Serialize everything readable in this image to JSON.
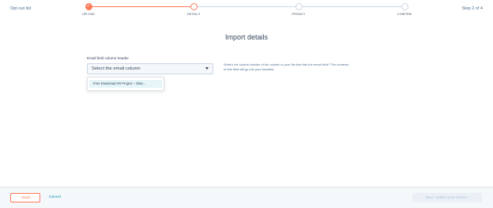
{
  "header": {
    "opt_out_list": "Opt out list",
    "step_count": "Step 2 of 4",
    "steps": [
      {
        "label": "UPLOAD",
        "state": "done"
      },
      {
        "label": "DETAILS",
        "state": "active"
      },
      {
        "label": "PRIVACY",
        "state": "pending"
      },
      {
        "label": "CONFIRM",
        "state": "pending"
      }
    ],
    "done_icon": "✓"
  },
  "main": {
    "title": "Import details",
    "field_label": "Email field column header",
    "select_value": "Select the email column",
    "dropdown_option": "Free Download AR Project – Shar...",
    "help_text": "What's the column header of the column in your file that has the email field? The contents of this field will go into your blocklist."
  },
  "footer": {
    "back_label": "‹  Back",
    "cancel_label": "Cancel",
    "next_label": "Next: confirm your choice  ›"
  },
  "colors": {
    "accent": "#ff7a59",
    "link": "#0091ae",
    "text": "#33475b"
  }
}
